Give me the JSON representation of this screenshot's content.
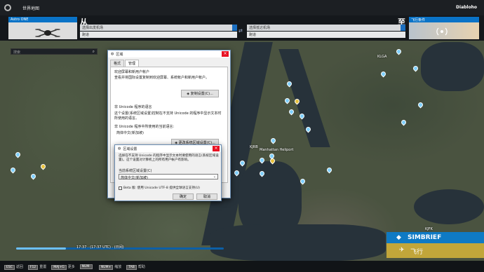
{
  "topbar": {
    "title": "世界地图",
    "user": "Diabloho"
  },
  "aircraft": {
    "label": "Astro ONE"
  },
  "departure": {
    "heading": "从",
    "airport": "选择出发机场",
    "runway": "跑道"
  },
  "arrival": {
    "heading": "至",
    "airport": "选择抵达机场",
    "runway": "跑道"
  },
  "flight_conditions": {
    "label": "飞行条件"
  },
  "search": {
    "placeholder": "搜索"
  },
  "map_labels": [
    "KJFK",
    "KLGA",
    "KJRB",
    "Manhattan Heliport",
    "KTEB"
  ],
  "dialog1": {
    "title": "区域",
    "tabs": [
      "格式",
      "管理"
    ],
    "welcome_heading": "欢迎屏幕和新用户帐户",
    "welcome_text": "查看并将国际设置复制到欢迎屏幕、系统帐户和新用户帐户。",
    "copy_button": "复制设置(C)...",
    "unicode_heading": "非 Unicode 程序的语言",
    "unicode_text": "这个设置(系统区域设置)控制在不支持 Unicode 的程序中显示文本时所使用的语言。",
    "current_label": "非 Unicode 程序中所使用的当前语言:",
    "current_value": "简体中文(新加坡)",
    "change_button": "更改系统区域设置(C)..."
  },
  "dialog2": {
    "title": "区域设置",
    "desc": "选择在不支持 Unicode 的程序中显示文本时要使用的语言(系统区域设置)。这个设置对计算机上的所有用户帐户有影响。",
    "locale_label": "当前系统区域设置(C)",
    "locale_value": "简体中文(新加坡)",
    "beta_label": "Beta 版: 使用 Unicode UTF-8 提供全球语言支持(U)",
    "ok": "确定",
    "cancel": "取消"
  },
  "time": {
    "text": "17:37 · (17:37 UTC) · (日间)",
    "progress": 0.24
  },
  "simbrief": {
    "label": "SIMBRIEF"
  },
  "fly": {
    "label": "飞行"
  },
  "bottom": [
    {
      "key": "ESC",
      "label": "返回"
    },
    {
      "key": "F12",
      "label": "重置"
    },
    {
      "key": "MAJ+G",
      "label": "更多"
    },
    {
      "key": "NUM-",
      "label": ""
    },
    {
      "key": "NUM+",
      "label": "缩放"
    },
    {
      "key": "TAB",
      "label": "帮助"
    }
  ]
}
